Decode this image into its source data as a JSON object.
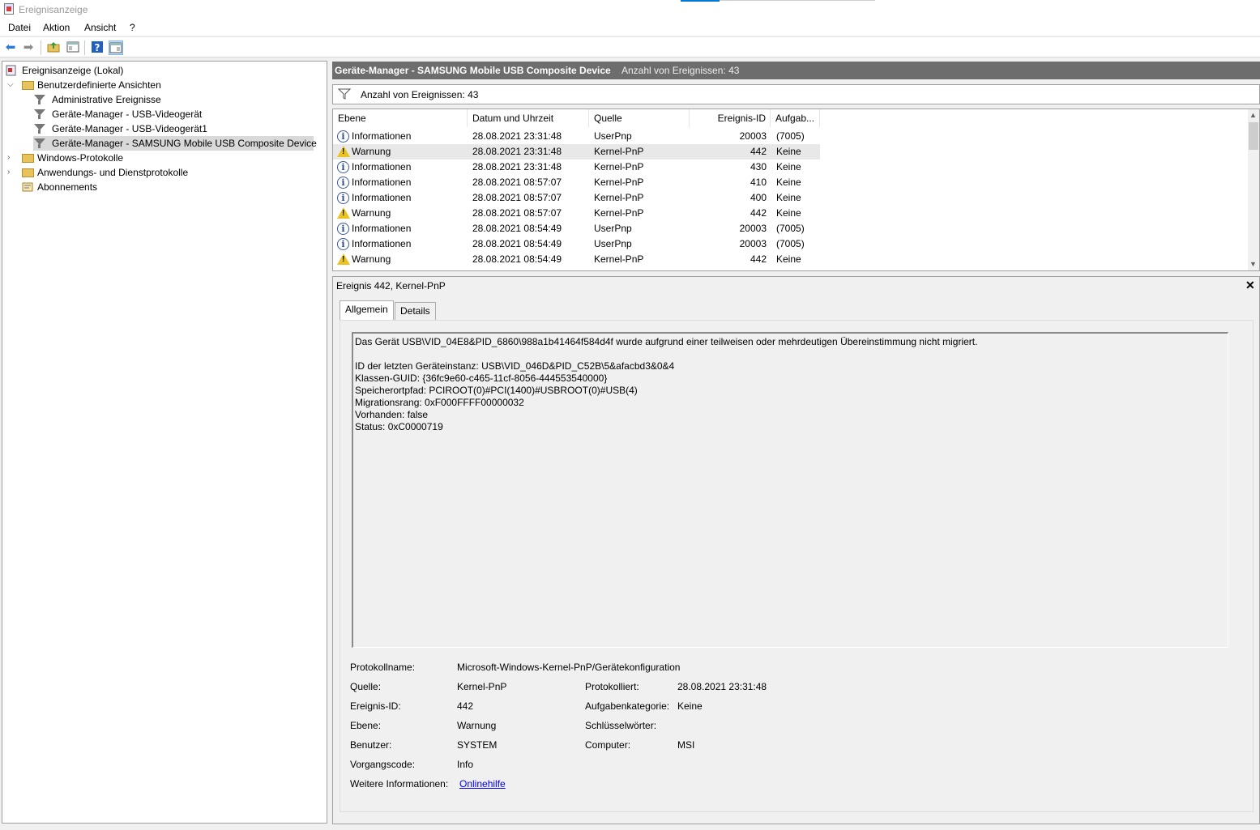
{
  "window": {
    "title": "Ereignisanzeige"
  },
  "menu": [
    "Datei",
    "Aktion",
    "Ansicht",
    "?"
  ],
  "toolbar": {
    "icons": [
      "back-arrow-icon",
      "forward-arrow-icon",
      "folder-up-icon",
      "show-hide-console-tree-icon",
      "help-icon",
      "show-hide-action-pane-icon"
    ]
  },
  "tree": {
    "root": "Ereignisanzeige (Lokal)",
    "custom_views": "Benutzerdefinierte Ansichten",
    "custom_children": [
      "Administrative Ereignisse",
      "Geräte-Manager - USB-Videogerät",
      "Geräte-Manager - USB-Videogerät1",
      "Geräte-Manager - SAMSUNG Mobile USB Composite Device"
    ],
    "windows_logs": "Windows-Protokolle",
    "app_logs": "Anwendungs- und Dienstprotokolle",
    "subscriptions": "Abonnements"
  },
  "list": {
    "title": "Geräte-Manager - SAMSUNG Mobile USB Composite Device",
    "count_label": "Anzahl von Ereignissen: 43",
    "filter_label": "Anzahl von Ereignissen: 43",
    "columns": [
      "Ebene",
      "Datum und Uhrzeit",
      "Quelle",
      "Ereignis-ID",
      "Aufgab..."
    ],
    "rows": [
      {
        "level": "Informationen",
        "icon": "info-icon",
        "date": "28.08.2021 23:31:48",
        "source": "UserPnp",
        "id": "20003",
        "task": "(7005)"
      },
      {
        "level": "Warnung",
        "icon": "warning-icon",
        "date": "28.08.2021 23:31:48",
        "source": "Kernel-PnP",
        "id": "442",
        "task": "Keine"
      },
      {
        "level": "Informationen",
        "icon": "info-icon",
        "date": "28.08.2021 23:31:48",
        "source": "Kernel-PnP",
        "id": "430",
        "task": "Keine"
      },
      {
        "level": "Informationen",
        "icon": "info-icon",
        "date": "28.08.2021 08:57:07",
        "source": "Kernel-PnP",
        "id": "410",
        "task": "Keine"
      },
      {
        "level": "Informationen",
        "icon": "info-icon",
        "date": "28.08.2021 08:57:07",
        "source": "Kernel-PnP",
        "id": "400",
        "task": "Keine"
      },
      {
        "level": "Warnung",
        "icon": "warning-icon",
        "date": "28.08.2021 08:57:07",
        "source": "Kernel-PnP",
        "id": "442",
        "task": "Keine"
      },
      {
        "level": "Informationen",
        "icon": "info-icon",
        "date": "28.08.2021 08:54:49",
        "source": "UserPnp",
        "id": "20003",
        "task": "(7005)"
      },
      {
        "level": "Informationen",
        "icon": "info-icon",
        "date": "28.08.2021 08:54:49",
        "source": "UserPnp",
        "id": "20003",
        "task": "(7005)"
      },
      {
        "level": "Warnung",
        "icon": "warning-icon",
        "date": "28.08.2021 08:54:49",
        "source": "Kernel-PnP",
        "id": "442",
        "task": "Keine"
      }
    ]
  },
  "detail": {
    "title": "Ereignis 442, Kernel-PnP",
    "tabs": [
      "Allgemein",
      "Details"
    ],
    "message_lines": [
      "Das Gerät USB\\VID_04E8&PID_6860\\988a1b41464f584d4f wurde aufgrund einer teilweisen oder mehrdeutigen Übereinstimmung nicht migriert.",
      "",
      "ID der letzten Geräteinstanz: USB\\VID_046D&PID_C52B\\5&afacbd3&0&4",
      "Klassen-GUID: {36fc9e60-c465-11cf-8056-444553540000}",
      "Speicherortpfad: PCIROOT(0)#PCI(1400)#USBROOT(0)#USB(4)",
      "Migrationsrang: 0xF000FFFF00000032",
      "Vorhanden: false",
      "Status: 0xC0000719"
    ],
    "props": {
      "log_name_label": "Protokollname:",
      "log_name": "Microsoft-Windows-Kernel-PnP/Gerätekonfiguration",
      "source_label": "Quelle:",
      "source": "Kernel-PnP",
      "logged_label": "Protokolliert:",
      "logged": "28.08.2021 23:31:48",
      "event_id_label": "Ereignis-ID:",
      "event_id": "442",
      "task_label": "Aufgabenkategorie:",
      "task": "Keine",
      "level_label": "Ebene:",
      "level": "Warnung",
      "keywords_label": "Schlüsselwörter:",
      "keywords": "",
      "user_label": "Benutzer:",
      "user": "SYSTEM",
      "computer_label": "Computer:",
      "computer": "MSI",
      "opcode_label": "Vorgangscode:",
      "opcode": "Info",
      "more_info_label": "Weitere Informationen:",
      "more_info_link": "Onlinehilfe"
    }
  }
}
